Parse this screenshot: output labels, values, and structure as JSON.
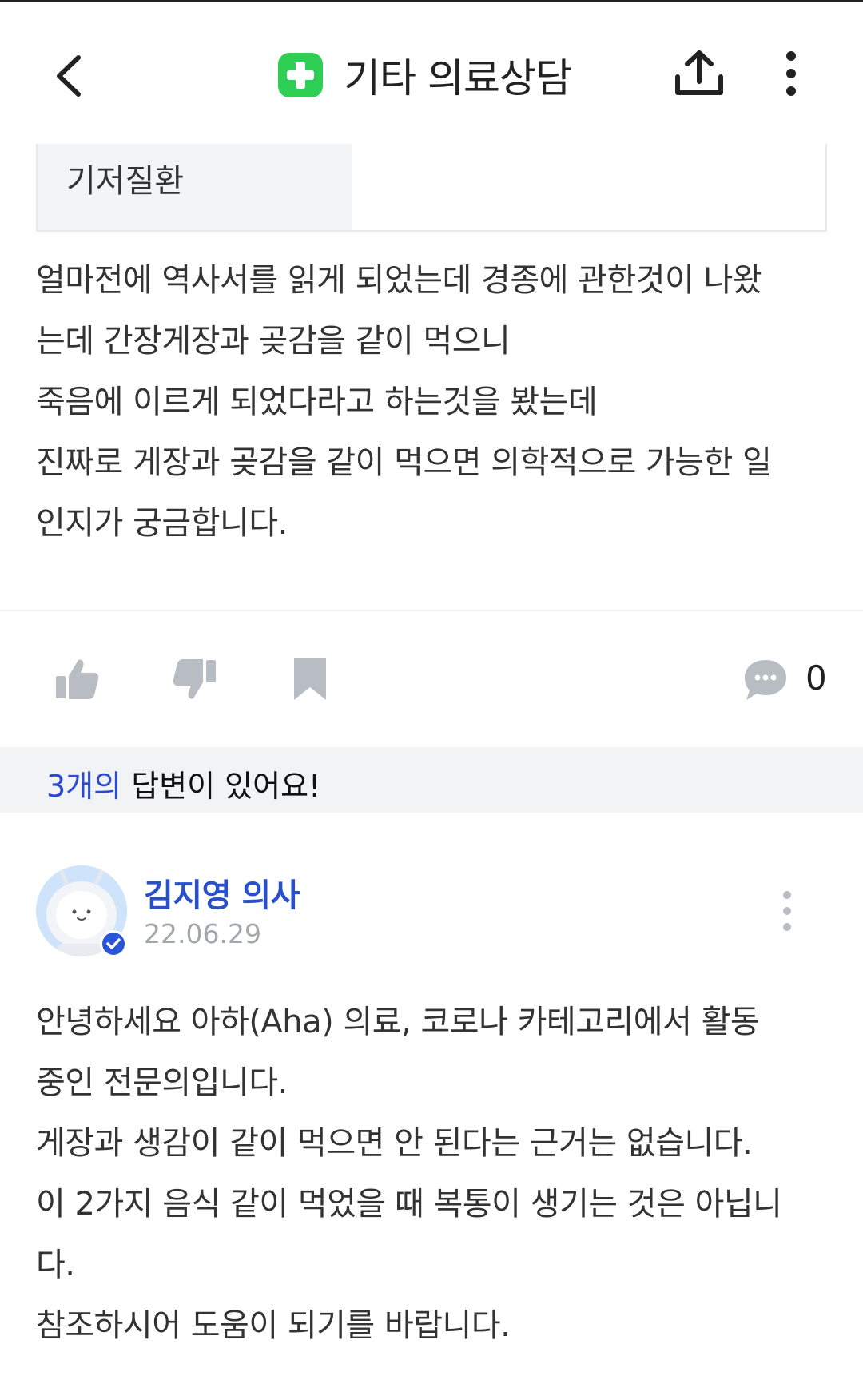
{
  "header": {
    "title": "기타 의료상담"
  },
  "info_table": {
    "label": "기저질환"
  },
  "question": {
    "lines": [
      "얼마전에 역사서를 읽게 되었는데 경종에 관한것이 나왔",
      "는데 간장게장과 곶감을 같이 먹으니",
      "죽음에 이르게 되었다라고 하는것을 봤는데",
      "진짜로 게장과 곶감을 같이 먹으면 의학적으로 가능한 일",
      "인지가 궁금합니다."
    ]
  },
  "actions": {
    "comment_count": "0"
  },
  "answers_banner": {
    "count": "3개의",
    "text": " 답변이 있어요!"
  },
  "answer": {
    "author": "김지영 의사",
    "date": "22.06.29",
    "lines": [
      "안녕하세요 아하(Aha) 의료, 코로나 카테고리에서 활동",
      "중인 전문의입니다.",
      "게장과 생감이 같이 먹으면 안 된다는 근거는 없습니다.",
      "이 2가지 음식 같이 먹었을 때 복통이 생기는 것은 아닙니",
      "다.",
      "참조하시어 도움이 되기를 바랍니다."
    ]
  },
  "colors": {
    "accent_green": "#2fcf55",
    "link_blue": "#2950c9",
    "banner_bg": "#f2f3f5",
    "icon_gray": "#b8bdc3"
  },
  "icons": [
    "back-arrow-icon",
    "medical-plus-icon",
    "share-icon",
    "more-vertical-icon",
    "thumbs-up-icon",
    "thumbs-down-icon",
    "bookmark-icon",
    "comment-icon",
    "verified-badge-icon"
  ]
}
